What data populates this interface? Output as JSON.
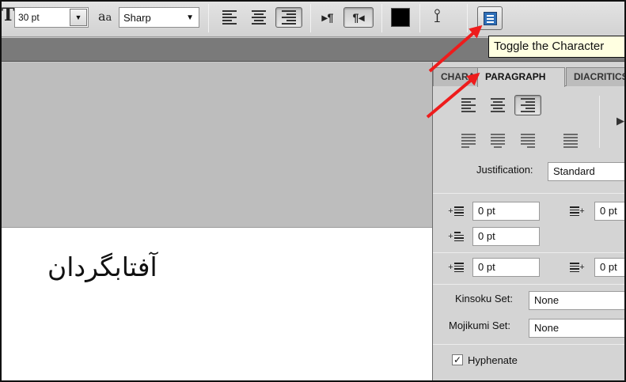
{
  "toolbar": {
    "type_tool_icon": "T",
    "font_size": "30 pt",
    "antialias_icon_main": "a",
    "antialias_icon_sub": "a",
    "antialias": "Sharp",
    "ltr_dir_glyph": "▸¶",
    "rtl_dir_glyph": "¶◂",
    "text_color": "#000000",
    "warp_glyph": "⟟"
  },
  "tooltip": {
    "text": "Toggle the Character"
  },
  "document": {
    "text": "آفتابگردان"
  },
  "panel": {
    "tabs": [
      "CHARACTER",
      "PARAGRAPH",
      "DIACRITICS"
    ],
    "justification_label": "Justification:",
    "justification_value": "Standard",
    "indent_left": "0 pt",
    "indent_right": "0 pt",
    "indent_first": "0 pt",
    "space_before": "0 pt",
    "space_after": "0 pt",
    "kinsoku_label": "Kinsoku Set:",
    "kinsoku_value": "None",
    "mojikumi_label": "Mojikumi Set:",
    "mojikumi_value": "None",
    "hyphenate_label": "Hyphenate",
    "hyphenate_checked": "✓",
    "flyout_glyph": "▶"
  },
  "colors": {
    "arrow": "#ee1c1c",
    "tooltip_bg": "#ffffe1"
  }
}
